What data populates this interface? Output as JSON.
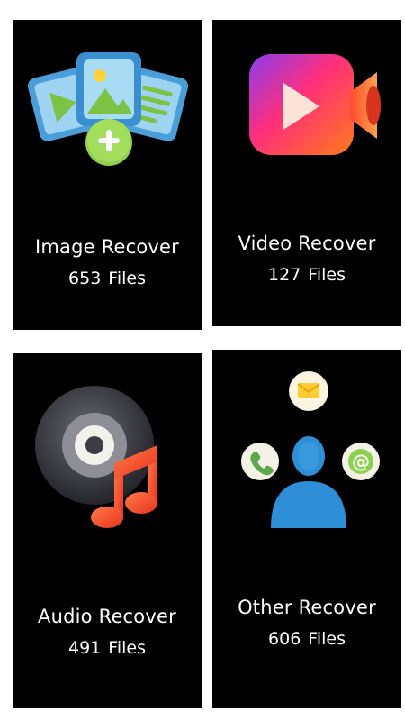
{
  "cards": [
    {
      "id": "image",
      "title": "Image Recover",
      "count": "653",
      "unit": "Files",
      "icon": "image-gallery-add-icon"
    },
    {
      "id": "video",
      "title": "Video Recover",
      "count": "127",
      "unit": "Files",
      "icon": "video-camera-icon"
    },
    {
      "id": "audio",
      "title": "Audio Recover",
      "count": "491",
      "unit": "Files",
      "icon": "music-disc-icon"
    },
    {
      "id": "other",
      "title": "Other Recover",
      "count": "606",
      "unit": "Files",
      "icon": "contact-person-icon"
    }
  ],
  "colors": {
    "card_background": "#000000",
    "page_background": "#ffffff",
    "text": "#ffffff"
  }
}
